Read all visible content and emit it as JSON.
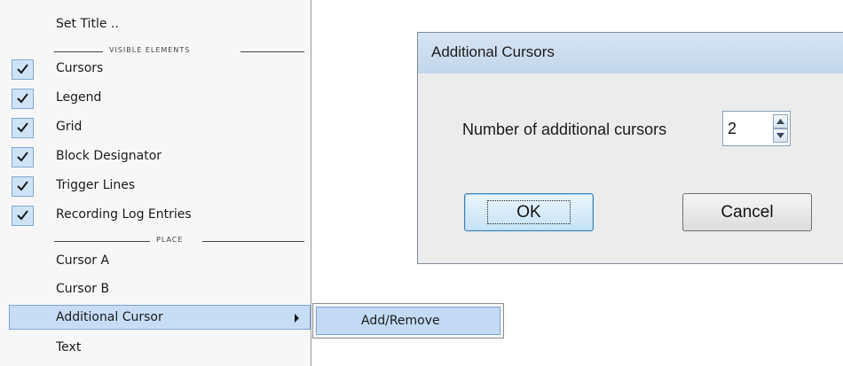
{
  "menu": {
    "set_title": "Set Title ..",
    "sections": {
      "visible_elements": "VISIBLE ELEMENTS",
      "place": "PLACE"
    },
    "visible_items": [
      {
        "label": "Cursors",
        "checked": true
      },
      {
        "label": "Legend",
        "checked": true
      },
      {
        "label": "Grid",
        "checked": true
      },
      {
        "label": "Block Designator",
        "checked": true
      },
      {
        "label": "Trigger Lines",
        "checked": true
      },
      {
        "label": "Recording Log Entries",
        "checked": true
      }
    ],
    "place_items": [
      {
        "label": "Cursor A"
      },
      {
        "label": "Cursor B"
      },
      {
        "label": "Additional Cursor",
        "has_submenu": true,
        "selected": true
      },
      {
        "label": "Text"
      }
    ]
  },
  "submenu": {
    "items": [
      {
        "label": "Add/Remove",
        "selected": true
      }
    ]
  },
  "dialog": {
    "title": "Additional Cursors",
    "field_label": "Number of additional cursors",
    "field_value": "2",
    "ok_label": "OK",
    "cancel_label": "Cancel"
  },
  "colors": {
    "selection_bg": "#c7ddf6",
    "selection_border": "#7ba3d8",
    "check_bg": "#cfe3f7",
    "titlebar": "#c8daee"
  },
  "icons": {
    "check": "check-icon",
    "submenu_arrow": "chevron-right-icon",
    "spin_up": "arrow-up-icon",
    "spin_down": "arrow-down-icon"
  }
}
